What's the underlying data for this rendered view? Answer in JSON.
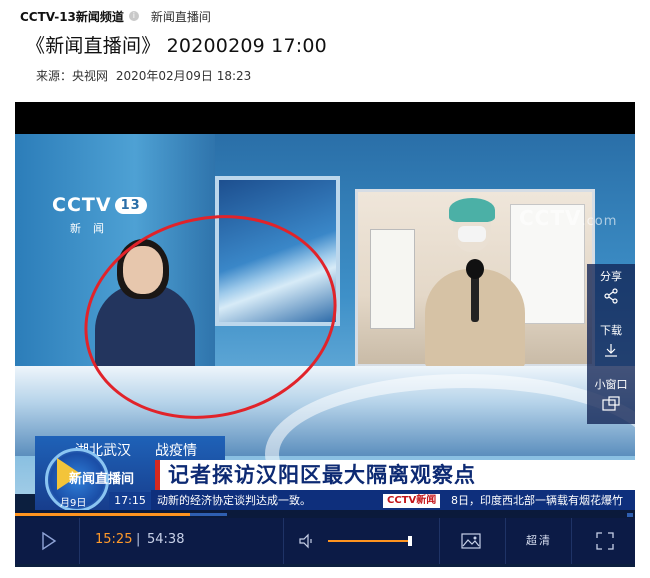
{
  "header": {
    "channel_name": "CCTV-13新闻频道",
    "channel_icon": "info-circle-icon",
    "program_link": "新闻直播间",
    "title": "《新闻直播间》 20200209 17:00",
    "source_label": "来源：央视网",
    "publish_time": "2020年02月09日 18:23"
  },
  "video": {
    "channel_logo": "CCTV",
    "channel_logo_number": "13",
    "channel_logo_sub": "新闻",
    "watermark": "CCTV",
    "watermark_suffix": ".com",
    "side_actions": [
      {
        "label": "分享",
        "icon": "share-icon"
      },
      {
        "label": "下载",
        "icon": "download-icon"
      },
      {
        "label": "小窗口",
        "icon": "mini-window-icon"
      }
    ],
    "lower_third": {
      "location": "湖北武汉",
      "tag": "战疫情",
      "headline": "记者探访汉阳区最大隔离观察点",
      "show_name": "新闻直播间",
      "date": "月9日",
      "time": "17:15",
      "ticker_text_1": "动新的经济协定谈判达成一致。",
      "ticker_logo": "CCTV新闻",
      "ticker_text_2": "8日，印度西北部一辆载有烟花爆竹"
    },
    "annotation_color": "#e1232a"
  },
  "player": {
    "current_time": "15:25",
    "divider": "|",
    "duration": "54:38",
    "progress_fraction": 0.282,
    "volume_fraction": 1.0,
    "quality_label": "超清",
    "accent_color": "#ff9420",
    "bar_color": "#0c1b46"
  }
}
